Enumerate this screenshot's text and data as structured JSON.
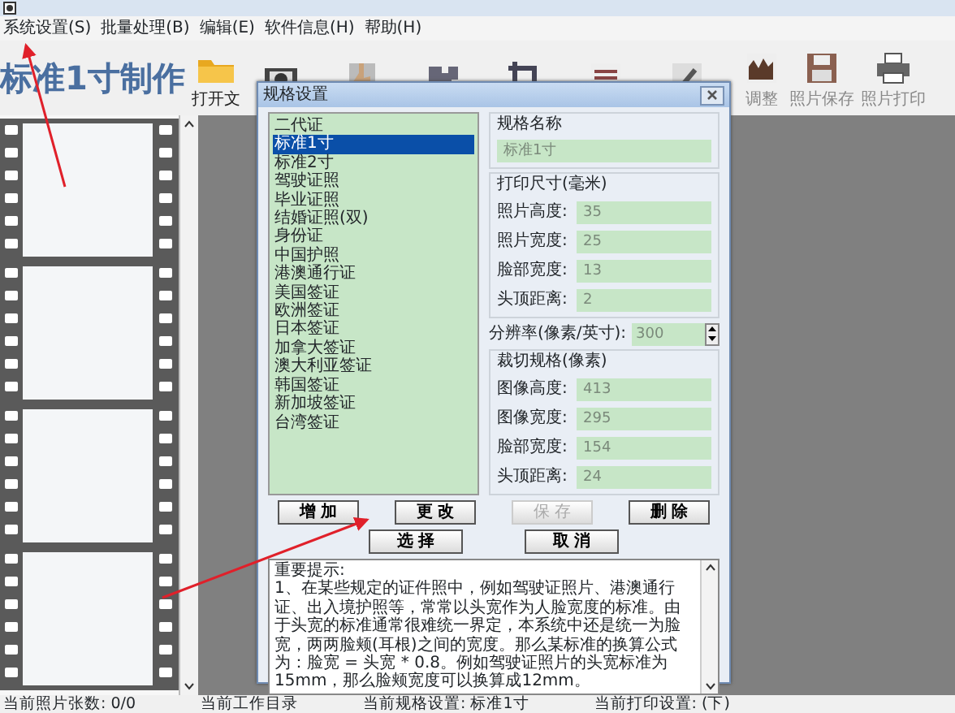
{
  "menu": [
    {
      "label": "系统设置(S)"
    },
    {
      "label": "批量处理(B)"
    },
    {
      "label": "编辑(E)"
    },
    {
      "label": "软件信息(H)"
    },
    {
      "label": "帮助(H)"
    }
  ],
  "app_title": "标准1寸制作",
  "toolbar": [
    {
      "label": "打开文"
    },
    {
      "label": "调整"
    },
    {
      "label": "照片保存"
    },
    {
      "label": "照片打印"
    }
  ],
  "dialog": {
    "title": "规格设置",
    "spec_list": [
      {
        "label": "二代证",
        "selected": false
      },
      {
        "label": "标准1寸",
        "selected": true
      },
      {
        "label": "标准2寸",
        "selected": false
      },
      {
        "label": "驾驶证照",
        "selected": false
      },
      {
        "label": "毕业证照",
        "selected": false
      },
      {
        "label": "结婚证照(双)",
        "selected": false
      },
      {
        "label": "身份证",
        "selected": false
      },
      {
        "label": "中国护照",
        "selected": false
      },
      {
        "label": "港澳通行证",
        "selected": false
      },
      {
        "label": "美国签证",
        "selected": false
      },
      {
        "label": "欧洲签证",
        "selected": false
      },
      {
        "label": "日本签证",
        "selected": false
      },
      {
        "label": "加拿大签证",
        "selected": false
      },
      {
        "label": "澳大利亚签证",
        "selected": false
      },
      {
        "label": "韩国签证",
        "selected": false
      },
      {
        "label": "新加坡签证",
        "selected": false
      },
      {
        "label": "台湾签证",
        "selected": false
      }
    ],
    "name_group": {
      "title": "规格名称",
      "value": "标准1寸"
    },
    "print_group": {
      "title": "打印尺寸(毫米)",
      "fields": [
        {
          "label": "照片高度:",
          "value": "35"
        },
        {
          "label": "照片宽度:",
          "value": "25"
        },
        {
          "label": "脸部宽度:",
          "value": "13"
        },
        {
          "label": "头顶距离:",
          "value": "2"
        }
      ]
    },
    "resolution": {
      "label": "分辨率(像素/英寸):",
      "value": "300"
    },
    "crop_group": {
      "title": "裁切规格(像素)",
      "fields": [
        {
          "label": "图像高度:",
          "value": "413"
        },
        {
          "label": "图像宽度:",
          "value": "295"
        },
        {
          "label": "脸部宽度:",
          "value": "154"
        },
        {
          "label": "头顶距离:",
          "value": "24"
        }
      ]
    },
    "edit_buttons": [
      {
        "label": "增 加",
        "disabled": false
      },
      {
        "label": "更 改",
        "disabled": false
      },
      {
        "label": "保 存",
        "disabled": true
      },
      {
        "label": "删 除",
        "disabled": false
      }
    ],
    "action_buttons": [
      {
        "label": "选 择"
      },
      {
        "label": "取 消"
      }
    ],
    "notes": {
      "heading": "重要提示:",
      "text": "1、在某些规定的证件照中，例如驾驶证照片、港澳通行证、出入境护照等，常常以头宽作为人脸宽度的标准。由于头宽的标准通常很难统一界定，本系统中还是统一为脸宽，两两脸颊(耳根)之间的宽度。那么某标准的换算公式为：脸宽 = 头宽 * 0.8。例如驾驶证照片的头宽标准为15mm，那么脸颊宽度可以换算成12mm。"
    }
  },
  "status_bar": [
    "当前照片张数: 0/0",
    "当前工作目录",
    "当前规格设置: 标准1寸",
    "当前打印设置: (下)"
  ]
}
